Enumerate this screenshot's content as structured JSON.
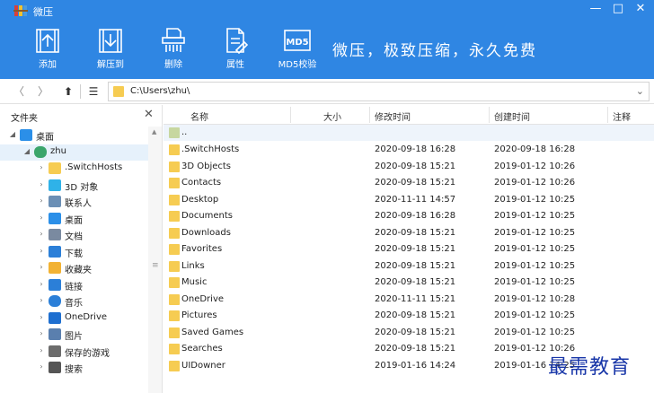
{
  "window": {
    "title": "微压",
    "icon": "winrar-books-icon",
    "controls": {
      "minimize": "—",
      "maximize": "□",
      "close": "✕"
    }
  },
  "ribbon": {
    "buttons": [
      {
        "label": "添加",
        "icon": "add-archive-icon"
      },
      {
        "label": "解压到",
        "icon": "extract-icon"
      },
      {
        "label": "删除",
        "icon": "shredder-delete-icon"
      },
      {
        "label": "属性",
        "icon": "properties-document-icon"
      },
      {
        "label": "MD5校验",
        "icon": "md5-icon",
        "icon_text": "MD5"
      }
    ],
    "slogan": "微压，极致压缩，永久免费"
  },
  "address": {
    "back": "〈",
    "forward": "〉",
    "up": "⬆",
    "list": "☰",
    "path": "C:\\Users\\zhu\\",
    "dropdown": "⌄"
  },
  "tree": {
    "title": "文件夹",
    "close": "✕",
    "items": [
      {
        "label": "桌面",
        "icon": "desktop-icon",
        "expand": "◢",
        "level": 0
      },
      {
        "label": "zhu",
        "icon": "user-icon",
        "expand": "◢",
        "level": 1
      },
      {
        "label": ".SwitchHosts",
        "icon": "folder-icon",
        "expand": "›",
        "level": 2
      },
      {
        "label": "3D 对象",
        "icon": "3d-objects-icon",
        "expand": "›",
        "level": 2
      },
      {
        "label": "联系人",
        "icon": "contacts-icon",
        "expand": "›",
        "level": 2
      },
      {
        "label": "桌面",
        "icon": "desktop-icon",
        "expand": "›",
        "level": 2
      },
      {
        "label": "文档",
        "icon": "documents-icon",
        "expand": "›",
        "level": 2
      },
      {
        "label": "下载",
        "icon": "download-icon",
        "expand": "›",
        "level": 2
      },
      {
        "label": "收藏夹",
        "icon": "favorites-star-icon",
        "expand": "›",
        "level": 2
      },
      {
        "label": "链接",
        "icon": "links-icon",
        "expand": "›",
        "level": 2
      },
      {
        "label": "音乐",
        "icon": "music-icon",
        "expand": "›",
        "level": 2
      },
      {
        "label": "OneDrive",
        "icon": "onedrive-cloud-icon",
        "expand": "›",
        "level": 2
      },
      {
        "label": "图片",
        "icon": "pictures-icon",
        "expand": "›",
        "level": 2
      },
      {
        "label": "保存的游戏",
        "icon": "saved-games-icon",
        "expand": "›",
        "level": 2
      },
      {
        "label": "搜索",
        "icon": "search-icon",
        "expand": "›",
        "level": 2
      }
    ]
  },
  "files": {
    "columns": {
      "name": "名称",
      "size": "大小",
      "modified": "修改时间",
      "created": "创建时间",
      "comment": "注释"
    },
    "parent": "..",
    "rows": [
      {
        "name": ".SwitchHosts",
        "modified": "2020-09-18 16:28",
        "created": "2020-09-18 16:28"
      },
      {
        "name": "3D Objects",
        "modified": "2020-09-18 15:21",
        "created": "2019-01-12 10:26"
      },
      {
        "name": "Contacts",
        "modified": "2020-09-18 15:21",
        "created": "2019-01-12 10:26"
      },
      {
        "name": "Desktop",
        "modified": "2020-11-11 14:57",
        "created": "2019-01-12 10:25"
      },
      {
        "name": "Documents",
        "modified": "2020-09-18 16:28",
        "created": "2019-01-12 10:25"
      },
      {
        "name": "Downloads",
        "modified": "2020-09-18 15:21",
        "created": "2019-01-12 10:25"
      },
      {
        "name": "Favorites",
        "modified": "2020-09-18 15:21",
        "created": "2019-01-12 10:25"
      },
      {
        "name": "Links",
        "modified": "2020-09-18 15:21",
        "created": "2019-01-12 10:25"
      },
      {
        "name": "Music",
        "modified": "2020-09-18 15:21",
        "created": "2019-01-12 10:25"
      },
      {
        "name": "OneDrive",
        "modified": "2020-11-11 15:21",
        "created": "2019-01-12 10:28"
      },
      {
        "name": "Pictures",
        "modified": "2020-09-18 15:21",
        "created": "2019-01-12 10:25"
      },
      {
        "name": "Saved Games",
        "modified": "2020-09-18 15:21",
        "created": "2019-01-12 10:25"
      },
      {
        "name": "Searches",
        "modified": "2020-09-18 15:21",
        "created": "2019-01-12 10:26"
      },
      {
        "name": "UIDowner",
        "modified": "2019-01-16 14:24",
        "created": "2019-01-16 14:25"
      }
    ]
  },
  "watermark": "最需教育",
  "colors": {
    "accent": "#2f86e3",
    "folder": "#f6cc52",
    "selection": "#e6f1fb",
    "watermark": "#1836a8"
  }
}
